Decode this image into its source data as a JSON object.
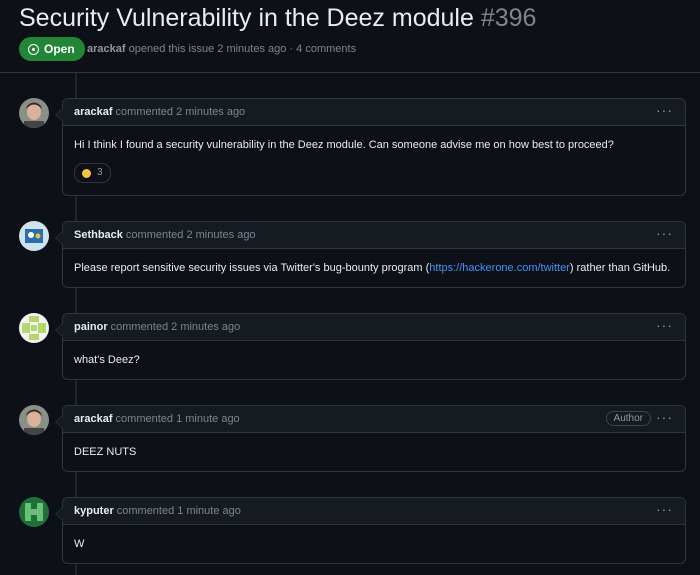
{
  "issue": {
    "title": "Security Vulnerability in the Deez module",
    "number": "#396",
    "state": "Open",
    "opener": "arackaf",
    "opened_text": "opened this issue 2 minutes ago · 4 comments"
  },
  "comments": [
    {
      "author": "arackaf",
      "meta": "commented 2 minutes ago",
      "body": "Hi I think I found a security vulnerability in the Deez module. Can someone advise me on how best to proceed?",
      "reaction_count": "3"
    },
    {
      "author": "Sethback",
      "meta": "commented 2 minutes ago",
      "body_pre": "Please report sensitive security issues via Twitter's bug-bounty program (",
      "link": "https://hackerone.com/twitter",
      "body_post": ") rather than GitHub."
    },
    {
      "author": "painor",
      "meta": "commented 2 minutes ago",
      "body": "what's Deez?"
    },
    {
      "author": "arackaf",
      "meta": "commented 1 minute ago",
      "badge": "Author",
      "body": "DEEZ NUTS"
    },
    {
      "author": "kyputer",
      "meta": "commented 1 minute ago",
      "body": "W"
    }
  ],
  "colors": {
    "open_green": "#238636",
    "link_blue": "#4493f8",
    "bg": "#0d1117"
  },
  "icons": {
    "state": "issue-opened-icon",
    "menu": "kebab-horizontal-icon",
    "reaction": "smile-icon"
  }
}
